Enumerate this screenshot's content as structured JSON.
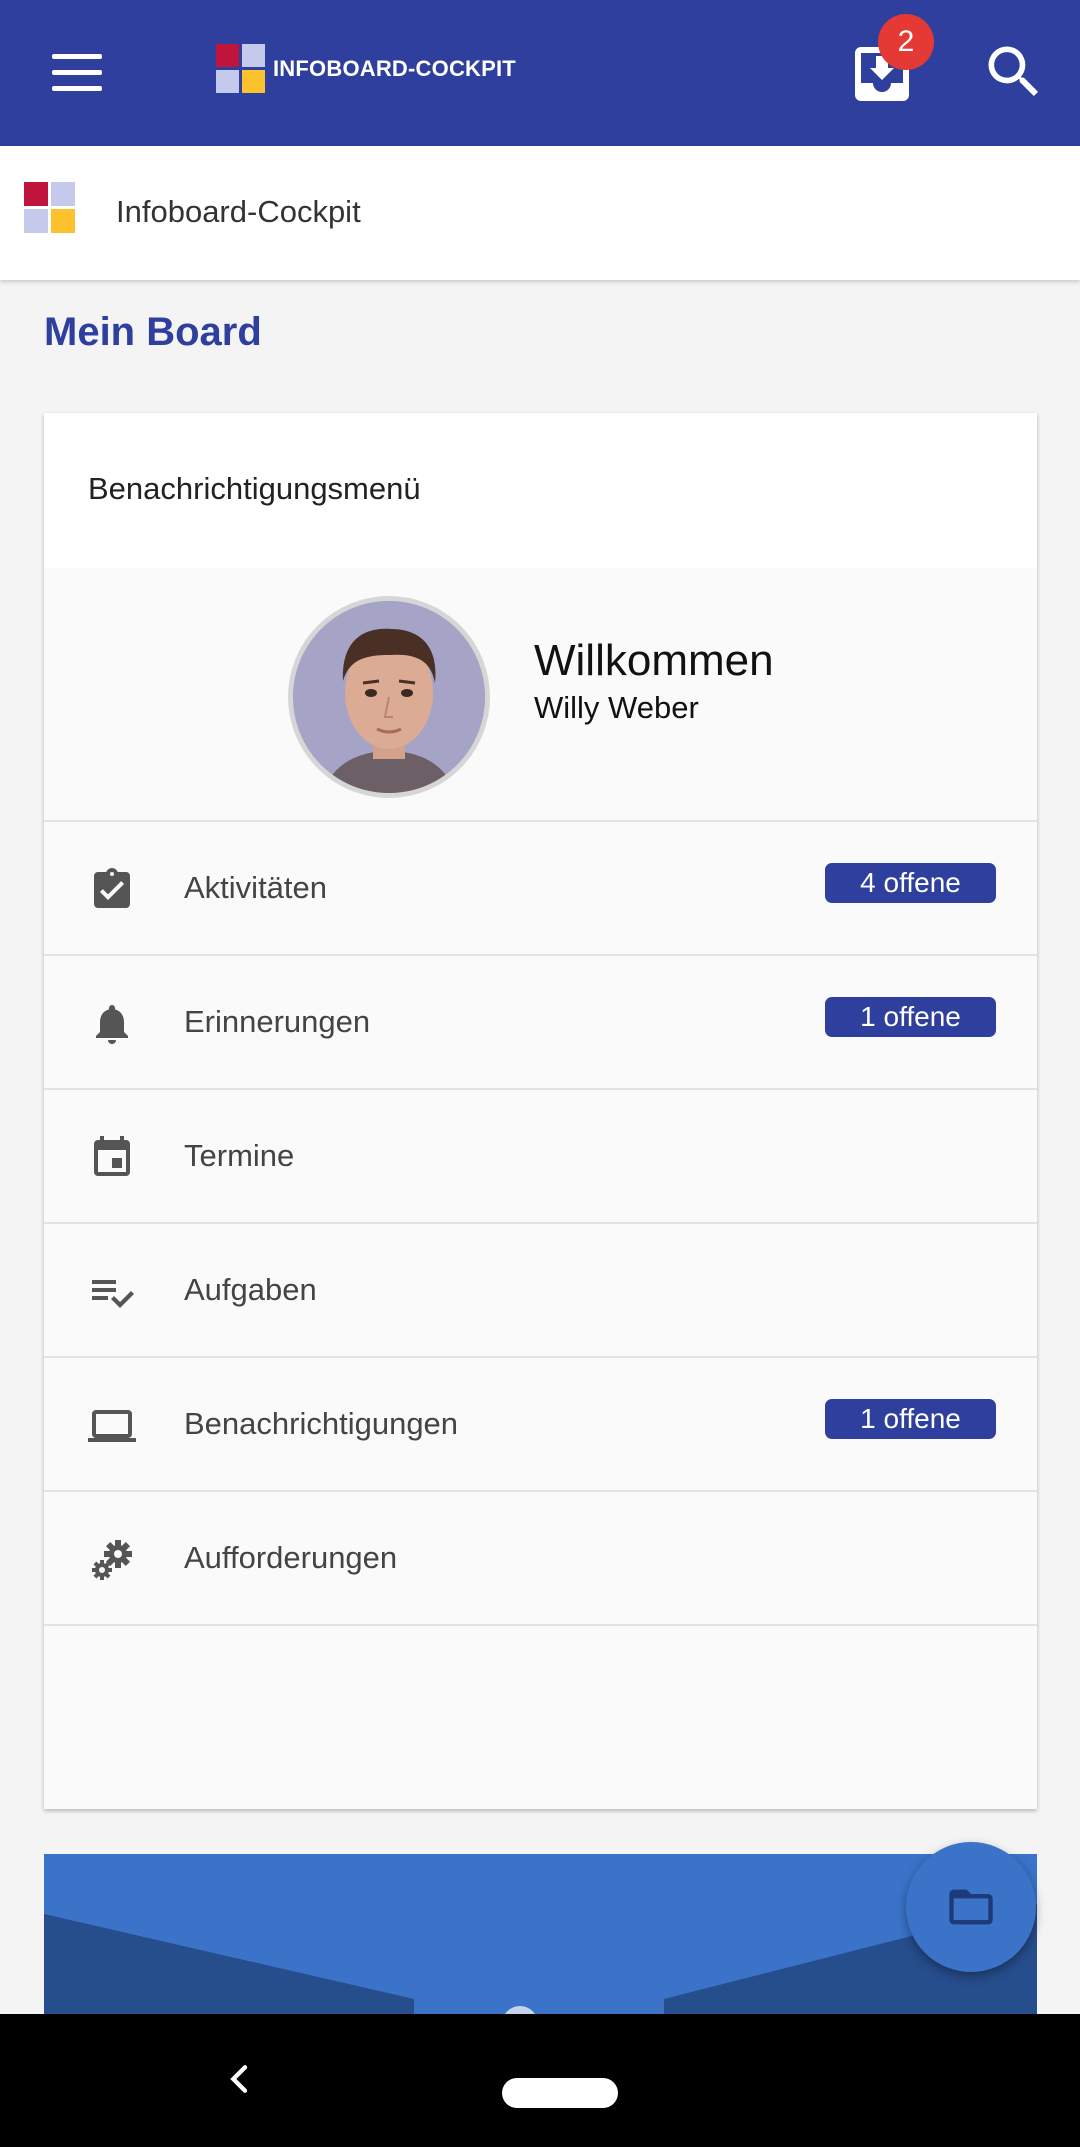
{
  "topbar": {
    "brand_text": "INFOBOARD-COCKPIT",
    "inbox_badge": "2"
  },
  "subheader": {
    "title": "Infoboard-Cockpit"
  },
  "page": {
    "title": "Mein Board"
  },
  "card": {
    "header": "Benachrichtigungsmenü",
    "welcome": "Willkommen",
    "user_name": "Willy Weber",
    "items": [
      {
        "label": "Aktivitäten",
        "icon": "clipboard-check-icon",
        "badge": "4 offene"
      },
      {
        "label": "Erinnerungen",
        "icon": "bell-icon",
        "badge": "1 offene"
      },
      {
        "label": "Termine",
        "icon": "calendar-icon"
      },
      {
        "label": "Aufgaben",
        "icon": "playlist-check-icon"
      },
      {
        "label": "Benachrichtigungen",
        "icon": "laptop-icon",
        "badge": "1 offene"
      },
      {
        "label": "Aufforderungen",
        "icon": "gears-icon"
      }
    ]
  },
  "colors": {
    "primary": "#2e3f9e",
    "badge_red": "#e53935",
    "banner_blue": "#3a73c8",
    "logo_red": "#c0143c",
    "logo_lavender": "#c5c9ec",
    "logo_yellow": "#fbc22d"
  }
}
